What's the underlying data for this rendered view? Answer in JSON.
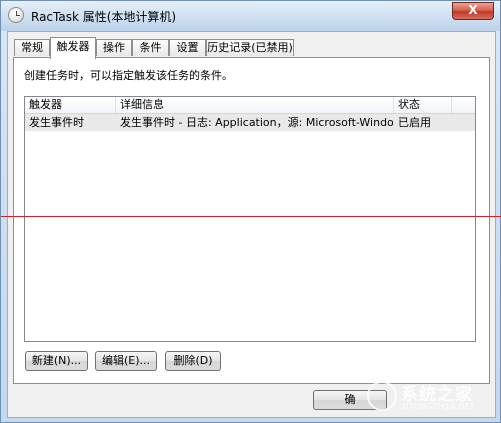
{
  "window": {
    "title": "RacTask 属性(本地计算机)",
    "close": "X"
  },
  "tabs": [
    {
      "label": "常规",
      "active": false
    },
    {
      "label": "触发器",
      "active": true
    },
    {
      "label": "操作",
      "active": false
    },
    {
      "label": "条件",
      "active": false
    },
    {
      "label": "设置",
      "active": false
    },
    {
      "label": "历史记录(已禁用)",
      "active": false
    }
  ],
  "panel": {
    "hint": "创建任务时，可以指定触发该任务的条件。"
  },
  "list": {
    "columns": [
      "触发器",
      "详细信息",
      "状态"
    ],
    "rows": [
      [
        "发生事件时",
        "发生事件时 - 日志: Application，源: Microsoft-Windows-CEI...",
        "已启用"
      ]
    ]
  },
  "buttons": {
    "new": "新建(N)...",
    "edit": "编辑(E)...",
    "delete": "删除(D)",
    "ok_partial": "确"
  },
  "watermark": {
    "brand": "系统之家",
    "site": "XITONGZHIJIA.NET"
  },
  "colors": {
    "guide_line": "#d81e2c"
  }
}
